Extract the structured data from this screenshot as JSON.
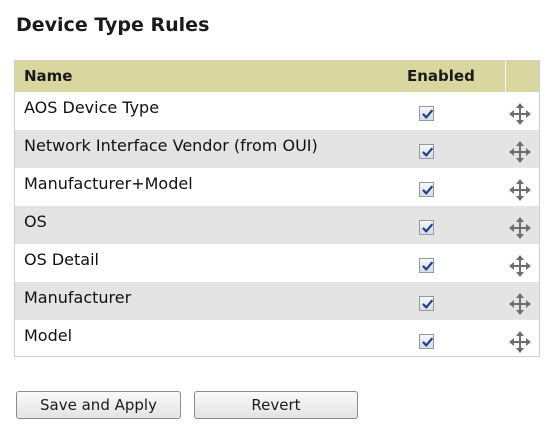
{
  "title": "Device Type Rules",
  "table": {
    "headers": {
      "name": "Name",
      "enabled": "Enabled"
    },
    "rows": [
      {
        "label": "AOS Device Type",
        "enabled": true
      },
      {
        "label": "Network Interface Vendor (from OUI)",
        "enabled": true
      },
      {
        "label": "Manufacturer+Model",
        "enabled": true
      },
      {
        "label": "OS",
        "enabled": true
      },
      {
        "label": "OS Detail",
        "enabled": true
      },
      {
        "label": "Manufacturer",
        "enabled": true
      },
      {
        "label": "Model",
        "enabled": true
      }
    ],
    "row_action_icon": "move-icon"
  },
  "buttons": {
    "save": "Save and Apply",
    "revert": "Revert"
  },
  "colors": {
    "header_bg": "#d9d6a0",
    "alt_row_bg": "#e4e4e4",
    "check_color": "#1f3e8f"
  }
}
